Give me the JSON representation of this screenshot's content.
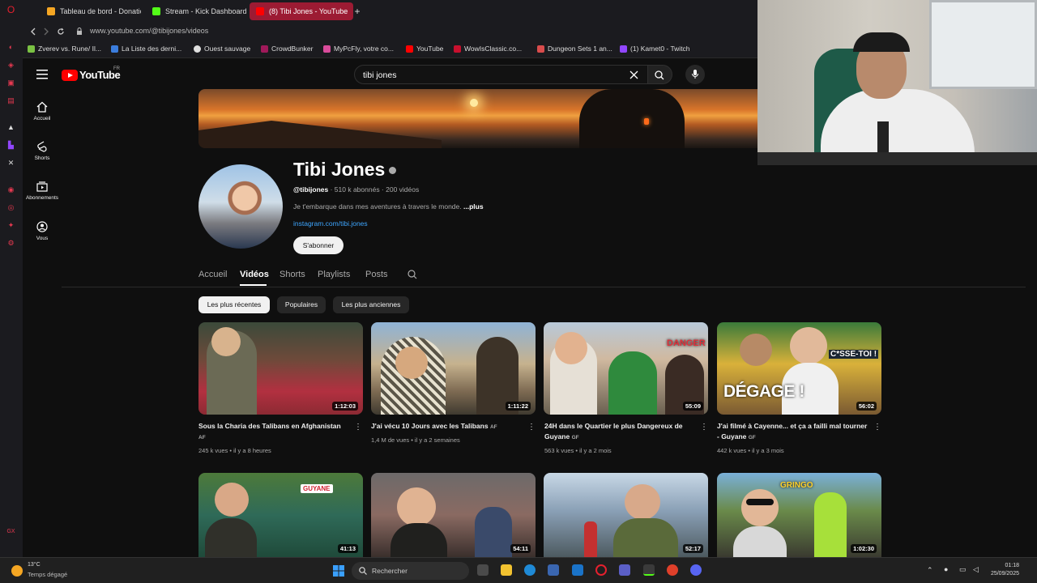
{
  "browser": {
    "tabs": [
      {
        "label": "Tableau de bord - Donatio",
        "color": "#f5a623"
      },
      {
        "label": "Stream - Kick Dashboard",
        "color": "#53fc18"
      },
      {
        "label": "(8) Tibi Jones - YouTube",
        "color": "#ff0000"
      }
    ],
    "new_tab_symbol": "+",
    "url": "www.youtube.com/@tibijones/videos",
    "bookmarks": [
      {
        "label": "Zverev vs. Rune/ Il...",
        "color": "#7ac143"
      },
      {
        "label": "La Liste des derni...",
        "color": "#3b7ddd"
      },
      {
        "label": "Ouest sauvage",
        "color": "#e0e0e0"
      },
      {
        "label": "CrowdBunker",
        "color": "#a0195a"
      },
      {
        "label": "MyPcFly, votre co...",
        "color": "#d94c9b"
      },
      {
        "label": "YouTube",
        "color": "#ff0000"
      },
      {
        "label": "WowIsClassic.co...",
        "color": "#c8102e"
      },
      {
        "label": "Dungeon Sets 1 an...",
        "color": "#d94c4c"
      },
      {
        "label": "(1) Kamet0 - Twitch",
        "color": "#9146ff"
      }
    ]
  },
  "youtube": {
    "logo_text": "YouTube",
    "country_code": "FR",
    "search_query": "tibi jones",
    "sidebar": [
      {
        "label": "Accueil",
        "icon": "home-icon"
      },
      {
        "label": "Shorts",
        "icon": "shorts-icon"
      },
      {
        "label": "Abonnements",
        "icon": "subscriptions-icon"
      },
      {
        "label": "Vous",
        "icon": "you-icon"
      }
    ],
    "channel": {
      "name": "Tibi Jones",
      "handle": "@tibijones",
      "stats": " · 510 k abonnés · 200 vidéos",
      "description": "Je t'embarque dans mes aventures à travers le monde. ",
      "more": "...plus",
      "link": "instagram.com/tibi.jones",
      "subscribe_label": "S'abonner"
    },
    "tabs": [
      "Accueil",
      "Vidéos",
      "Shorts",
      "Playlists",
      "Posts"
    ],
    "active_tab": "Vidéos",
    "chips": [
      "Les plus récentes",
      "Populaires",
      "Les plus anciennes"
    ],
    "videos": [
      {
        "title": "Sous la Charia des Talibans en Afghanistan",
        "tag": "AF",
        "meta": "245 k vues • il y a 8 heures",
        "duration": "1:12:03"
      },
      {
        "title": "J'ai vécu 10 Jours avec les Talibans",
        "tag": "AF",
        "meta": "1,4 M de vues • il y a 2 semaines",
        "duration": "1:11:22"
      },
      {
        "title": "24H dans le Quartier le plus Dangereux de Guyane",
        "tag": "GF",
        "meta": "563 k vues • il y a 2 mois",
        "duration": "55:09"
      },
      {
        "title": "J'ai filmé à Cayenne... et ça a failli mal tourner - Guyane",
        "tag": "GF",
        "meta": "442 k vues • il y a 3 mois",
        "duration": "56:02"
      },
      {
        "duration": "41:13"
      },
      {
        "duration": "54:11"
      },
      {
        "duration": "52:17"
      },
      {
        "duration": "1:02:30"
      }
    ],
    "thumb_overlay_texts": [
      "DANGER",
      "C*SSE-TOI !",
      "DÉGAGE !",
      "GUYANE",
      "GRINGO"
    ]
  },
  "taskbar": {
    "weather_temp": "13°C",
    "weather_desc": "Temps dégagé",
    "search_placeholder": "Rechercher",
    "time": "01:18",
    "date": "25/09/2025"
  }
}
